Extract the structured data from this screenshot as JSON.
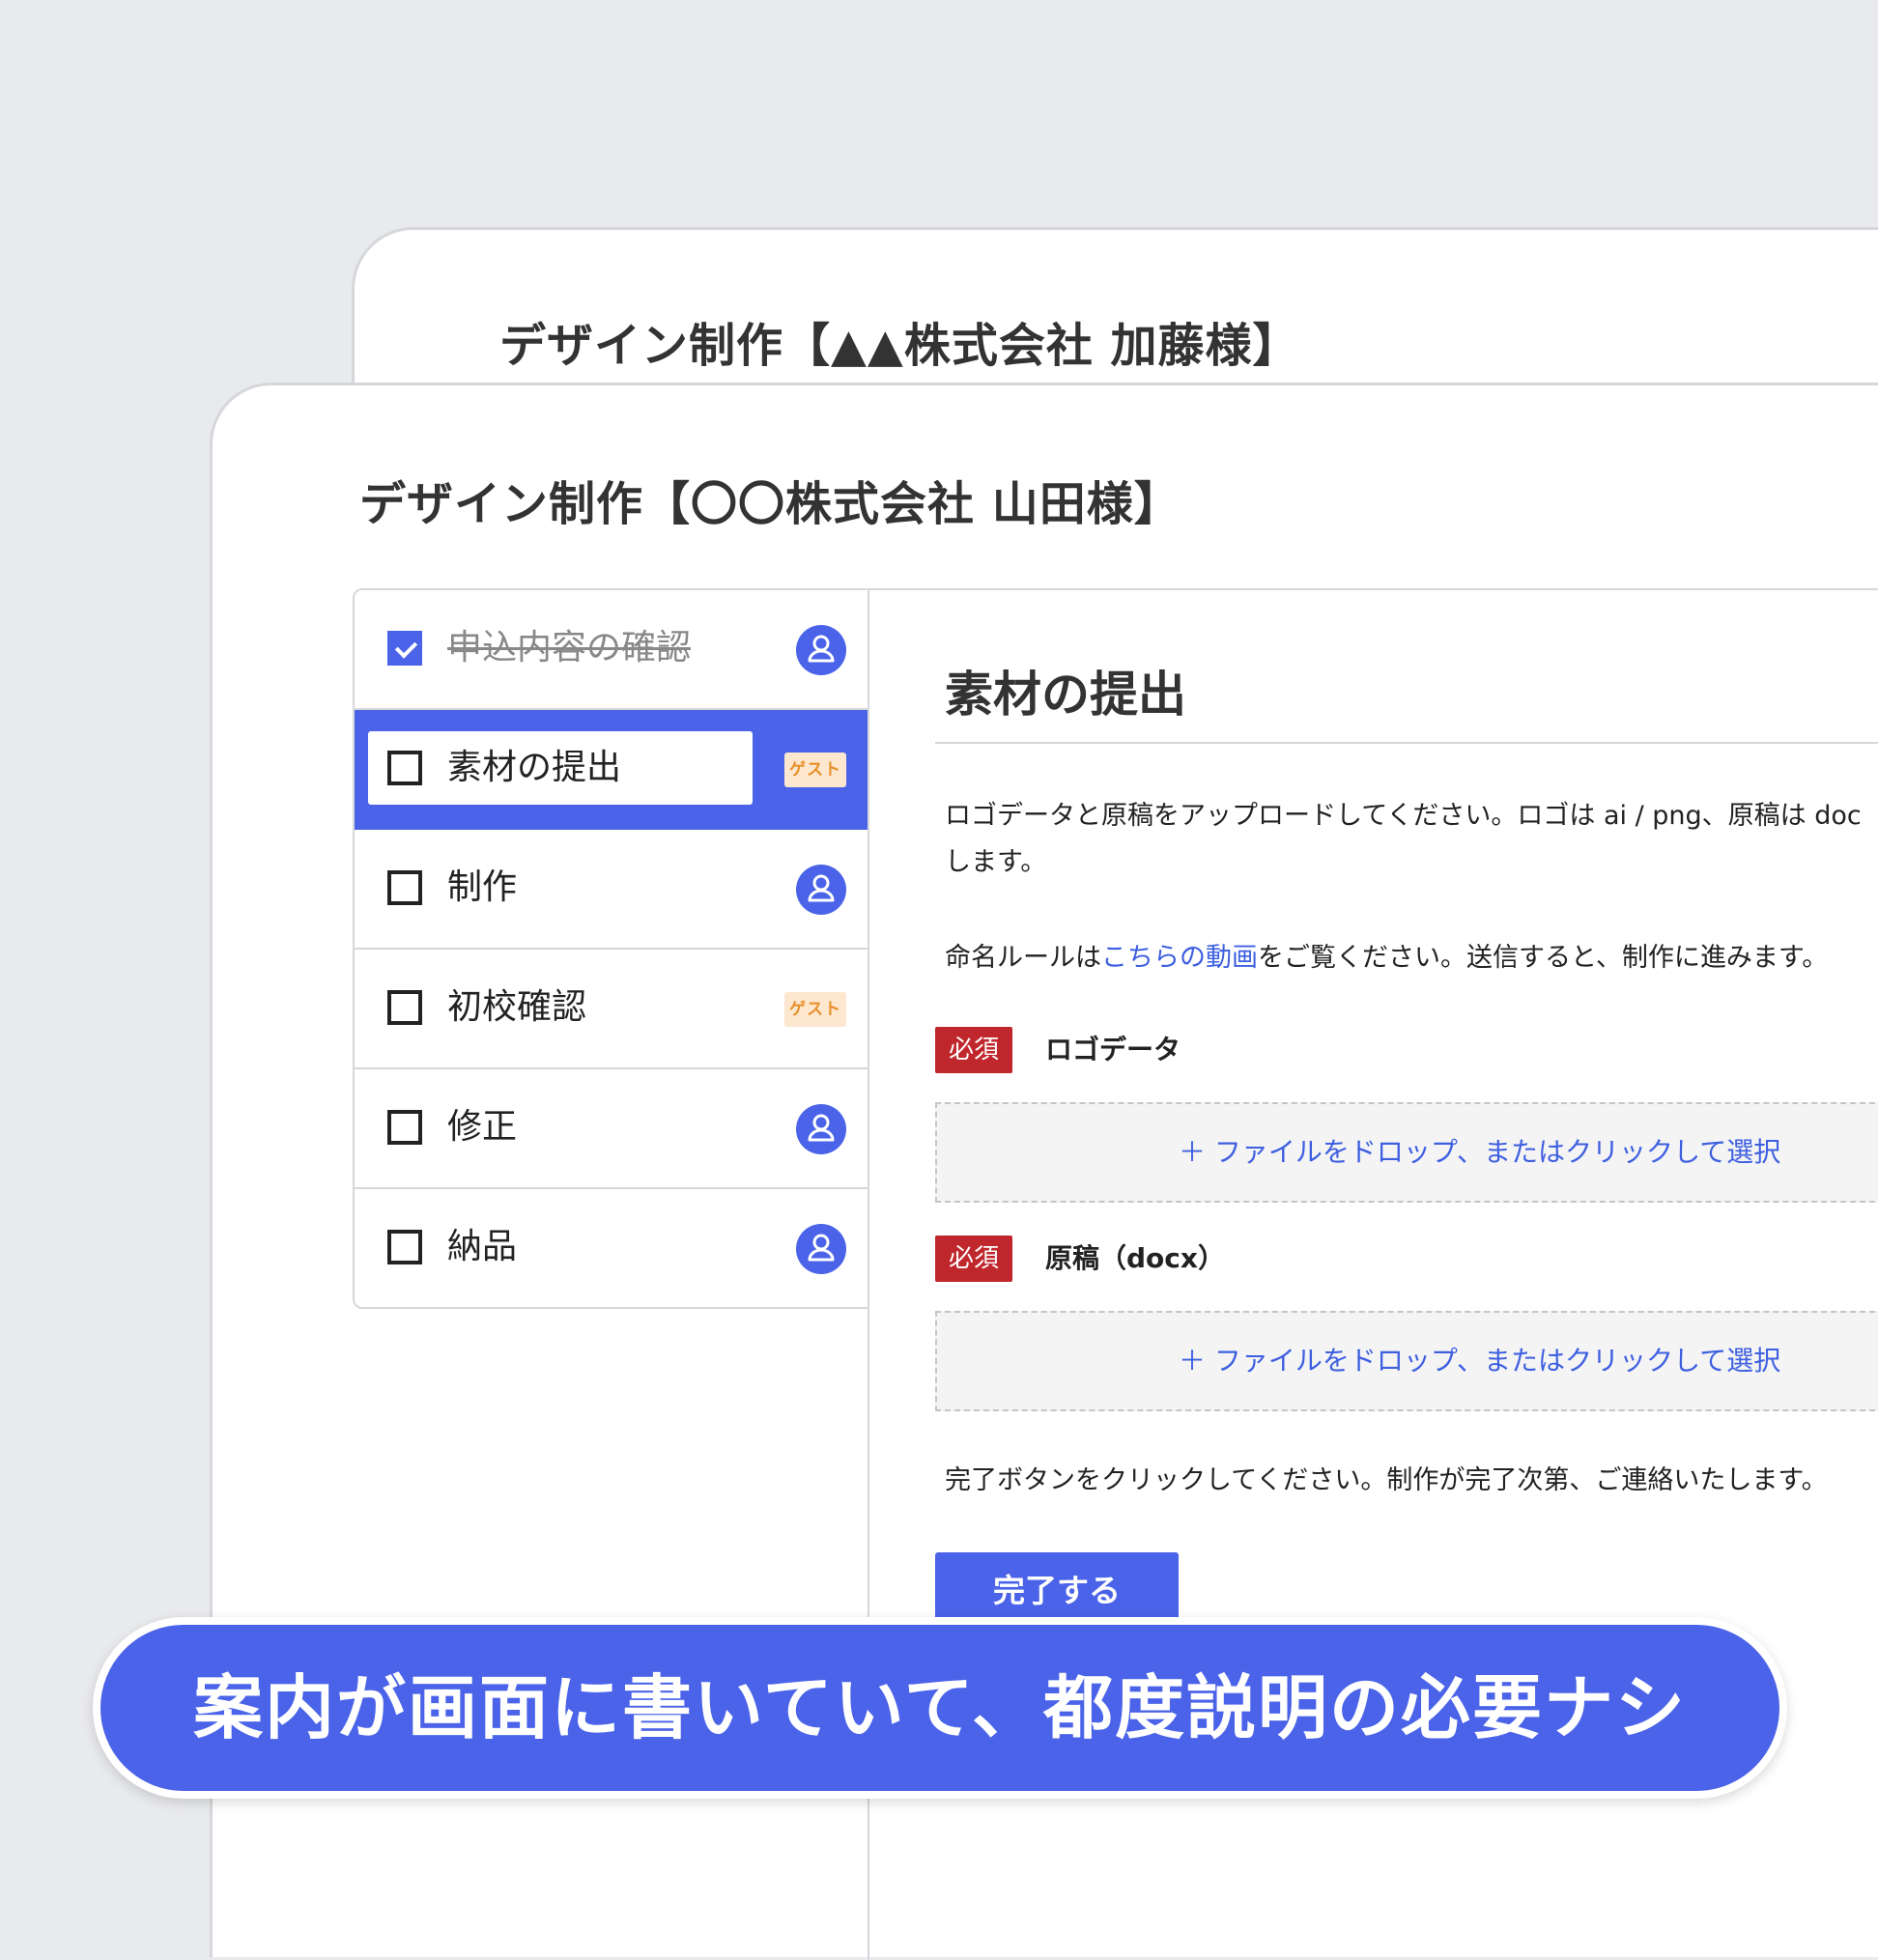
{
  "back_card": {
    "title": "デザイン制作【▲▲株式会社 加藤様】"
  },
  "front_card": {
    "title": "デザイン制作【〇〇株式会社 山田様】"
  },
  "tasks": [
    {
      "label": "申込内容の確認",
      "checked": true,
      "assignee": "user-icon"
    },
    {
      "label": "素材の提出",
      "checked": false,
      "active": true,
      "assignee_badge": "ゲスト"
    },
    {
      "label": "制作",
      "checked": false,
      "assignee": "user-icon"
    },
    {
      "label": "初校確認",
      "checked": false,
      "assignee_badge": "ゲスト"
    },
    {
      "label": "修正",
      "checked": false,
      "assignee": "user-icon"
    },
    {
      "label": "納品",
      "checked": false,
      "assignee": "user-icon"
    }
  ],
  "content": {
    "title": "素材の提出",
    "instruction_line1": "ロゴデータと原稿をアップロードしてください。ロゴは ai / png、原稿は doc",
    "instruction_line2": "します。",
    "instruction_naming_prefix": "命名ルールは",
    "instruction_naming_link": "こちらの動画",
    "instruction_naming_suffix": "をご覧ください。送信すると、制作に進みます。",
    "fields": [
      {
        "required_badge": "必須",
        "label": "ロゴデータ",
        "dropzone_text": "＋ ファイルをドロップ、またはクリックして選択"
      },
      {
        "required_badge": "必須",
        "label": "原稿（docx）",
        "dropzone_text": "＋ ファイルをドロップ、またはクリックして選択"
      }
    ],
    "completion_instruction": "完了ボタンをクリックしてください。制作が完了次第、ご連絡いたします。",
    "complete_button": "完了する"
  },
  "banner": {
    "text": "案内が画面に書いていて、都度説明の必要ナシ"
  },
  "colors": {
    "accent": "#4a63e8",
    "required": "#c0272d",
    "guest_bg": "#fde7cf",
    "guest_text": "#e8902a",
    "link": "#3e5fe0"
  }
}
